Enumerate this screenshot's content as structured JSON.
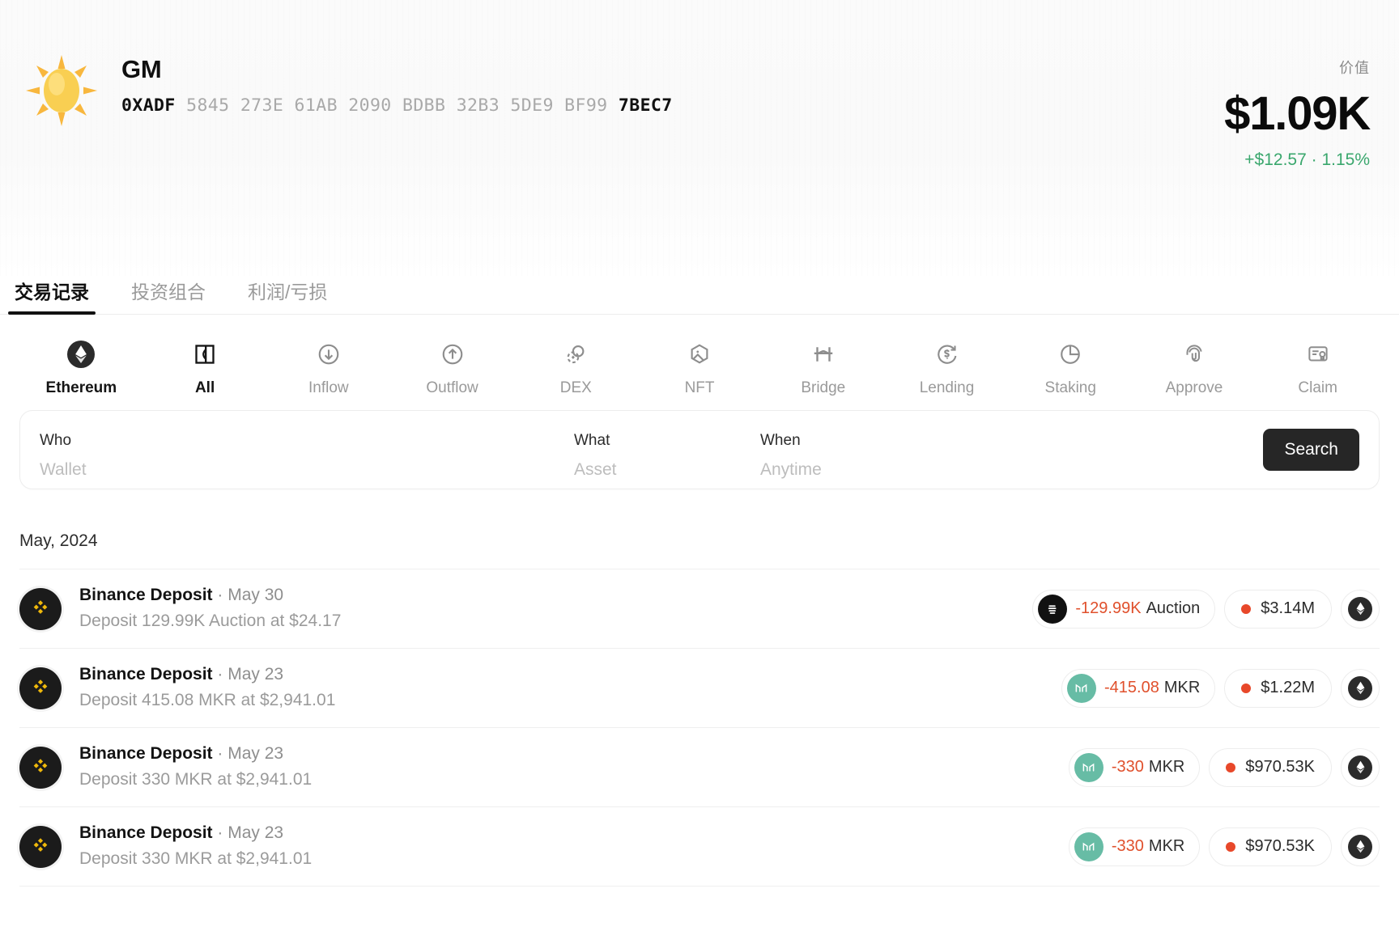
{
  "header": {
    "avatar_icon": "sun-emoji",
    "name": "GM",
    "address_prefix": "0XADF",
    "address_middle": "5845 273E 61AB 2090 BDBB 32B3 5DE9 BF99",
    "address_suffix": "7BEC7",
    "value_label": "价值",
    "value_amount": "$1.09K",
    "value_change": "+$12.57 · 1.15%",
    "change_color": "#3aa76d"
  },
  "tabs": [
    {
      "label": "交易记录",
      "active": true
    },
    {
      "label": "投资组合",
      "active": false
    },
    {
      "label": "利润/亏损",
      "active": false
    }
  ],
  "filters": [
    {
      "label": "Ethereum",
      "icon": "ethereum-icon",
      "active": true
    },
    {
      "label": "All",
      "icon": "all-icon",
      "active": true
    },
    {
      "label": "Inflow",
      "icon": "arrow-down-circle-icon",
      "active": false
    },
    {
      "label": "Outflow",
      "icon": "arrow-up-circle-icon",
      "active": false
    },
    {
      "label": "DEX",
      "icon": "dex-swap-icon",
      "active": false
    },
    {
      "label": "NFT",
      "icon": "nft-hexagon-icon",
      "active": false
    },
    {
      "label": "Bridge",
      "icon": "bridge-icon",
      "active": false
    },
    {
      "label": "Lending",
      "icon": "lending-dollar-icon",
      "active": false
    },
    {
      "label": "Staking",
      "icon": "staking-pie-icon",
      "active": false
    },
    {
      "label": "Approve",
      "icon": "fingerprint-icon",
      "active": false
    },
    {
      "label": "Claim",
      "icon": "claim-certificate-icon",
      "active": false
    }
  ],
  "search": {
    "who_label": "Who",
    "who_placeholder": "Wallet",
    "what_label": "What",
    "what_placeholder": "Asset",
    "when_label": "When",
    "when_placeholder": "Anytime",
    "button_label": "Search"
  },
  "month_group": "May, 2024",
  "transactions": [
    {
      "icon": "binance-icon",
      "title": "Binance Deposit",
      "date": "May 30",
      "detail": "Deposit 129.99K Auction at $24.17",
      "amount": "-129.99K",
      "symbol": "Auction",
      "token_icon": "auction-token-icon",
      "token_color": "#111111",
      "usd": "$3.14M",
      "chain_icon": "ethereum-icon"
    },
    {
      "icon": "binance-icon",
      "title": "Binance Deposit",
      "date": "May 23",
      "detail": "Deposit 415.08 MKR at $2,941.01",
      "amount": "-415.08",
      "symbol": "MKR",
      "token_icon": "maker-token-icon",
      "token_color": "#67bca5",
      "usd": "$1.22M",
      "chain_icon": "ethereum-icon"
    },
    {
      "icon": "binance-icon",
      "title": "Binance Deposit",
      "date": "May 23",
      "detail": "Deposit 330 MKR at $2,941.01",
      "amount": "-330",
      "symbol": "MKR",
      "token_icon": "maker-token-icon",
      "token_color": "#67bca5",
      "usd": "$970.53K",
      "chain_icon": "ethereum-icon"
    },
    {
      "icon": "binance-icon",
      "title": "Binance Deposit",
      "date": "May 23",
      "detail": "Deposit 330 MKR at $2,941.01",
      "amount": "-330",
      "symbol": "MKR",
      "token_icon": "maker-token-icon",
      "token_color": "#67bca5",
      "usd": "$970.53K",
      "chain_icon": "ethereum-icon"
    }
  ]
}
